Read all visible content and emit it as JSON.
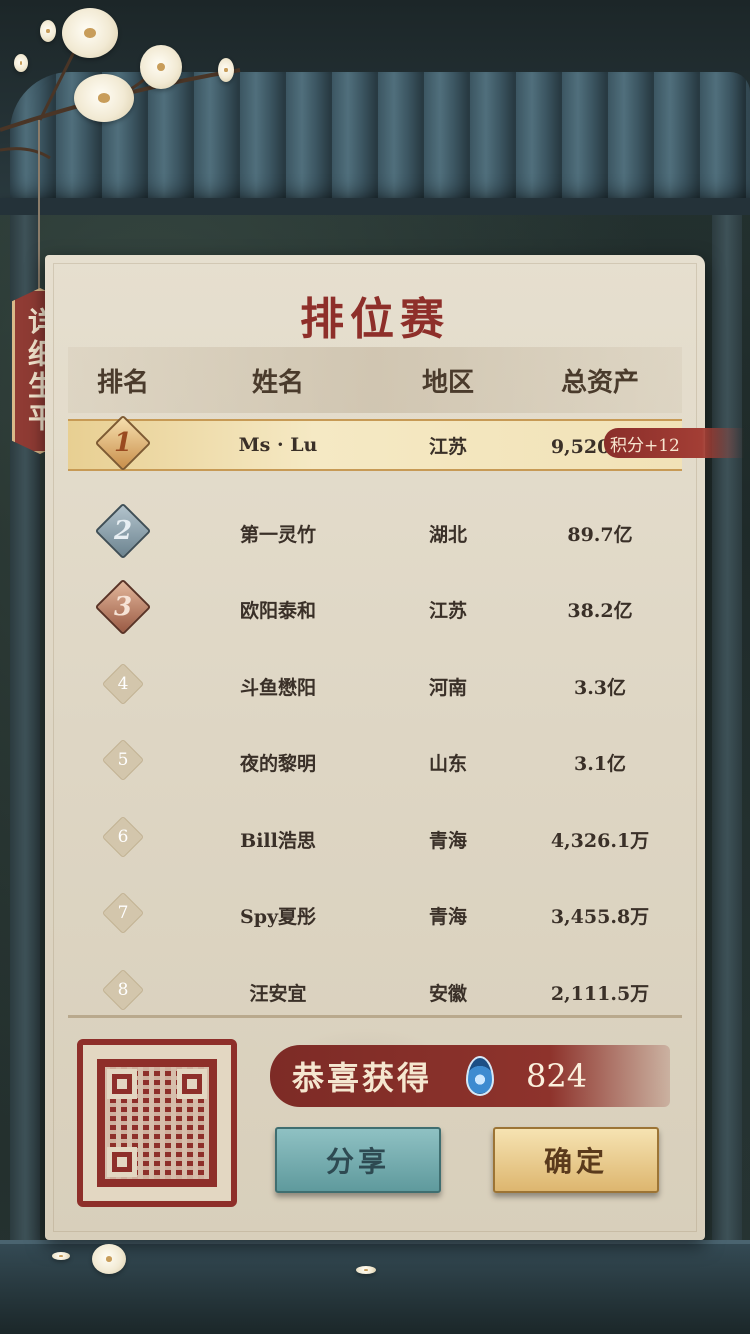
{
  "side_tag": {
    "label": "详细生平"
  },
  "title": "排位赛",
  "table": {
    "headers": {
      "rank": "排名",
      "name": "姓名",
      "region": "地区",
      "assets": "总资产"
    },
    "rows": [
      {
        "rank": "1",
        "name": "Ms · Lu",
        "region": "江苏",
        "assets": "9,520.7亿"
      },
      {
        "rank": "2",
        "name": "第一灵竹",
        "region": "湖北",
        "assets": "89.7亿"
      },
      {
        "rank": "3",
        "name": "欧阳泰和",
        "region": "江苏",
        "assets": "38.2亿"
      },
      {
        "rank": "4",
        "name": "斗鱼懋阳",
        "region": "河南",
        "assets": "3.3亿"
      },
      {
        "rank": "5",
        "name": "夜的黎明",
        "region": "山东",
        "assets": "3.1亿"
      },
      {
        "rank": "6",
        "name": "Bill浩思",
        "region": "青海",
        "assets": "4,326.1万"
      },
      {
        "rank": "7",
        "name": "Spy夏彤",
        "region": "青海",
        "assets": "3,455.8万"
      },
      {
        "rank": "8",
        "name": "汪安宜",
        "region": "安徽",
        "assets": "2,111.5万"
      }
    ]
  },
  "points_badge": "积分+12",
  "reward": {
    "label": "恭喜获得",
    "icon": "water-drop-icon",
    "count": "824"
  },
  "buttons": {
    "share": "分享",
    "confirm": "确定"
  },
  "colors": {
    "accent_red": "#8e2f2a",
    "paper": "#e6dfcf",
    "gold": "#ddb66f",
    "teal": "#5f9a9d"
  }
}
